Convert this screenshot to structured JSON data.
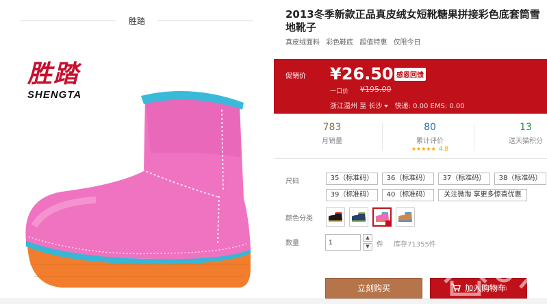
{
  "left": {
    "brand_header": "胜踏",
    "logo_cn": "胜踏",
    "logo_en": "SHENGTA"
  },
  "product": {
    "title": "2013冬季新款正品真皮绒女短靴糖果拼接彩色底套筒雪地靴子",
    "tags": [
      "真皮绒面料",
      "彩色鞋底",
      "超值特惠",
      "仅限今日"
    ]
  },
  "price": {
    "label": "促销价",
    "current": "¥26.50",
    "badge": "感恩回馈",
    "original_label": "一口价",
    "original": "¥195.00",
    "ship_from": "浙江温州",
    "ship_to_word": "至",
    "ship_to": "长沙",
    "delivery": "快递: 0.00 EMS: 0.00"
  },
  "stats": {
    "monthly_sales": "783",
    "monthly_sales_label": "月销量",
    "reviews": "80",
    "reviews_label": "累计评价",
    "stars": "★★★★★",
    "rating": "4.8",
    "points": "13",
    "points_label": "送天猫积分"
  },
  "options": {
    "size_label": "尺码",
    "sizes": [
      "35（标准码）",
      "36（标准码）",
      "37（标准码）",
      "38（标准码）",
      "39（标准码）",
      "40（标准码）",
      "关注微淘 享更多惊喜优惠"
    ],
    "color_label": "颜色分类",
    "qty_label": "数量",
    "qty_value": "1",
    "qty_unit": "件",
    "stock": "库存71355件"
  },
  "actions": {
    "buy_now": "立刻购买",
    "add_cart": "加入购物车"
  },
  "watermark": {
    "text": "0096123.com"
  },
  "colors": {
    "promo_red": "#c0101a",
    "buy_brown": "#b5744a",
    "swatches": [
      "#1a1a1a",
      "#2c3e6b",
      "#ef6bb4",
      "#c78a55"
    ]
  }
}
